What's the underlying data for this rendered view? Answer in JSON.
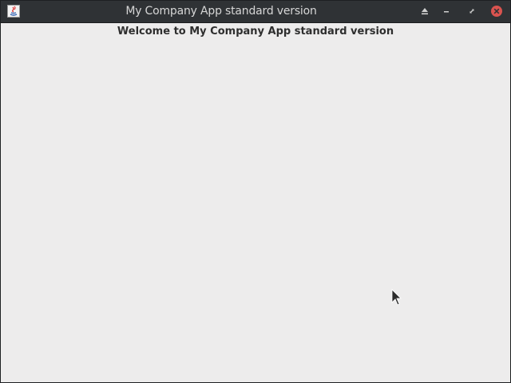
{
  "window": {
    "title": "My Company App standard version",
    "app_icon": "java-app-icon",
    "controls": [
      "shade-icon",
      "minimize-icon",
      "maximize-icon",
      "close-icon"
    ],
    "colors": {
      "titlebar": "#2f3235",
      "title_text": "#d6d6d6",
      "close_button": "#d9534f",
      "content_background": "#edecec"
    }
  },
  "main": {
    "welcome_label": "Welcome to My Company App standard version"
  },
  "cursor": {
    "icon": "mouse-pointer-icon"
  }
}
